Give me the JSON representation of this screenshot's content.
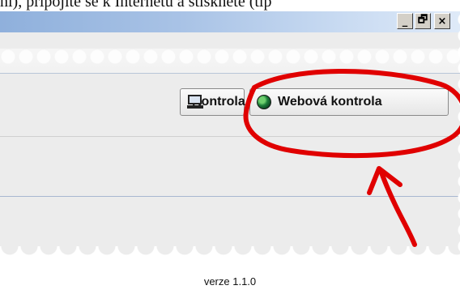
{
  "caption_fragment": "ní), připojíte se k Internetu a stiskněte (tip",
  "window_controls": {
    "minimize": "_",
    "maximize": "🗗",
    "close": "×"
  },
  "toolbar": {
    "kontrola_label": "Kontrola",
    "web_kontrola_label": "Webová kontrola",
    "kontrola_icon": "computer-icon",
    "web_kontrola_icon": "globe-icon"
  },
  "annotation": {
    "circle_color": "#e00000",
    "arrow_color": "#e00000"
  },
  "footer": {
    "version": "verze 1.1.0"
  }
}
